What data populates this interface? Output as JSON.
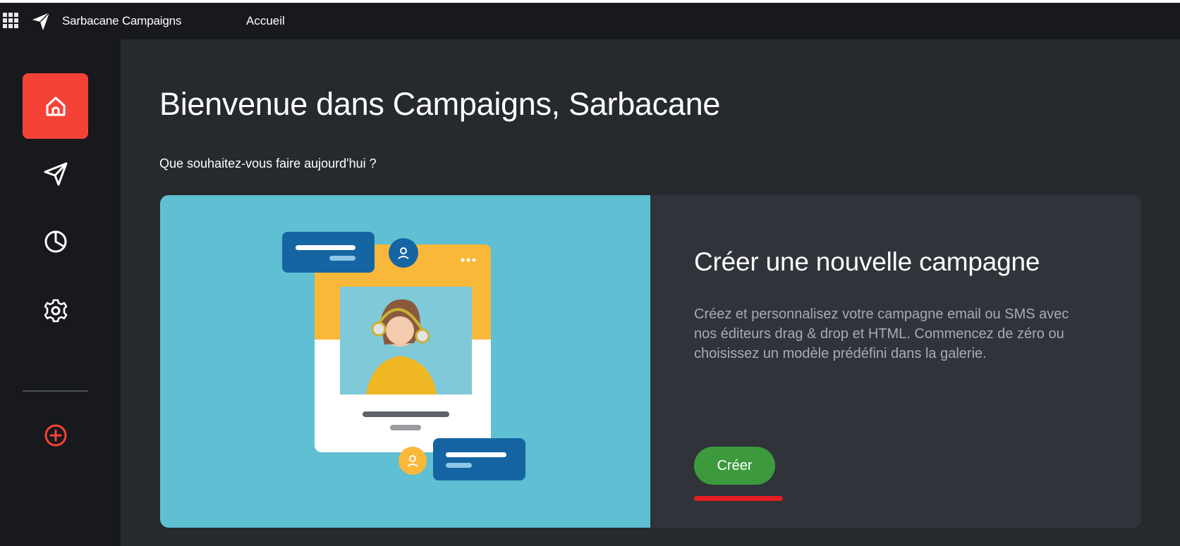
{
  "topbar": {
    "app_title": "Sarbacane Campaigns",
    "nav_home": "Accueil"
  },
  "sidebar": {
    "items": [
      {
        "icon": "home-icon",
        "active": true
      },
      {
        "icon": "send-icon",
        "active": false
      },
      {
        "icon": "pie-chart-icon",
        "active": false
      },
      {
        "icon": "settings-icon",
        "active": false
      },
      {
        "icon": "add-circle-icon",
        "active": false
      }
    ]
  },
  "main": {
    "title": "Bienvenue dans Campaigns, Sarbacane",
    "subtitle": "Que souhaitez-vous faire aujourd'hui ?"
  },
  "card": {
    "title": "Créer une nouvelle campagne",
    "description": "Créez et personnalisez votre campagne email ou SMS avec nos éditeurs drag & drop et HTML. Commencez de zéro ou choisissez un modèle prédéfini dans la galerie.",
    "button_label": "Créer"
  },
  "colors": {
    "accent_red": "#f44336",
    "button_green": "#3c9a3c",
    "illustration_bg": "#5ec0d2",
    "underline_red": "#e51c23"
  }
}
